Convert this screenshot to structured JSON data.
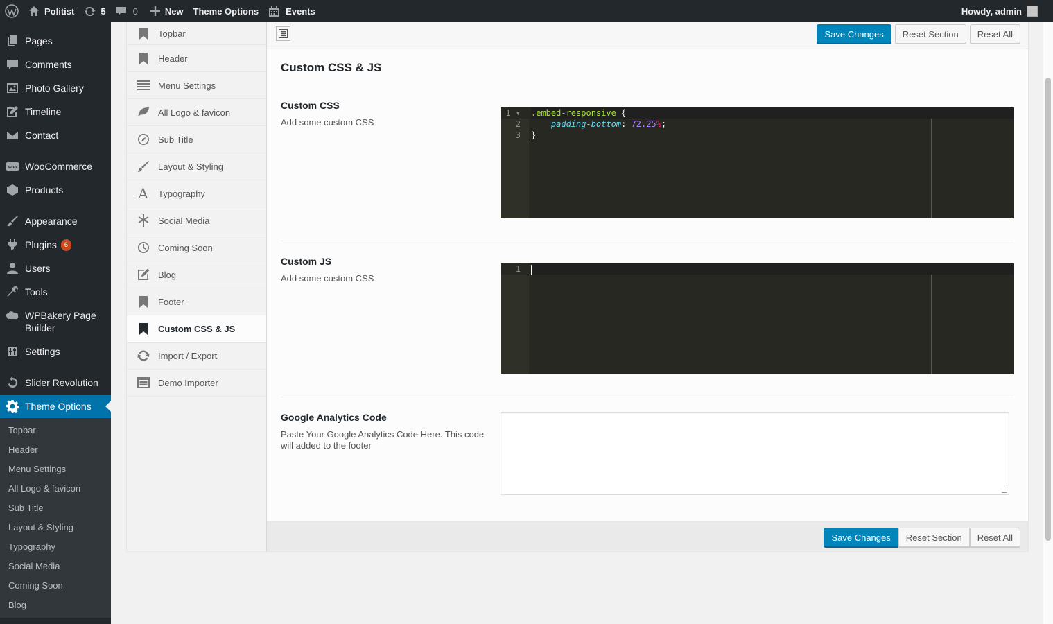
{
  "adminbar": {
    "site_name": "Politist",
    "updates_count": "5",
    "comments_count": "0",
    "new_label": "New",
    "theme_options_label": "Theme Options",
    "events_label": "Events",
    "howdy": "Howdy, admin"
  },
  "admin_menu": {
    "items": [
      {
        "label": "Pages",
        "icon": "pages-icon"
      },
      {
        "label": "Comments",
        "icon": "comments-icon"
      },
      {
        "label": "Photo Gallery",
        "icon": "gallery-icon"
      },
      {
        "label": "Timeline",
        "icon": "timeline-icon"
      },
      {
        "label": "Contact",
        "icon": "mail-icon"
      },
      {
        "label": "WooCommerce",
        "icon": "woo-icon"
      },
      {
        "label": "Products",
        "icon": "products-icon"
      },
      {
        "label": "Appearance",
        "icon": "appearance-icon"
      },
      {
        "label": "Plugins",
        "icon": "plugins-icon",
        "badge": "6"
      },
      {
        "label": "Users",
        "icon": "users-icon"
      },
      {
        "label": "Tools",
        "icon": "tools-icon"
      },
      {
        "label": "WPBakery Page Builder",
        "icon": "wpbakery-icon"
      },
      {
        "label": "Settings",
        "icon": "settings-icon"
      },
      {
        "label": "Slider Revolution",
        "icon": "slider-icon"
      },
      {
        "label": "Theme Options",
        "icon": "gear-icon",
        "current": true
      }
    ],
    "submenu": [
      "Topbar",
      "Header",
      "Menu Settings",
      "All Logo & favicon",
      "Sub Title",
      "Layout & Styling",
      "Typography",
      "Social Media",
      "Coming Soon",
      "Blog"
    ]
  },
  "redux_sidebar": {
    "items": [
      {
        "label": "Topbar",
        "icon": "bookmark-icon"
      },
      {
        "label": "Header",
        "icon": "bookmark-icon"
      },
      {
        "label": "Menu Settings",
        "icon": "menu-icon"
      },
      {
        "label": "All Logo & favicon",
        "icon": "leaf-icon"
      },
      {
        "label": "Sub Title",
        "icon": "compass-icon"
      },
      {
        "label": "Layout & Styling",
        "icon": "brush-icon"
      },
      {
        "label": "Typography",
        "icon": "typography-icon"
      },
      {
        "label": "Social Media",
        "icon": "asterisk-icon"
      },
      {
        "label": "Coming Soon",
        "icon": "clock-icon"
      },
      {
        "label": "Blog",
        "icon": "edit-icon"
      },
      {
        "label": "Footer",
        "icon": "bookmark-icon"
      },
      {
        "label": "Custom CSS & JS",
        "icon": "bookmark-icon",
        "active": true
      },
      {
        "label": "Import / Export",
        "icon": "refresh-icon"
      },
      {
        "label": "Demo Importer",
        "icon": "importer-icon"
      }
    ]
  },
  "buttons": {
    "save": "Save Changes",
    "reset_section": "Reset Section",
    "reset_all": "Reset All"
  },
  "section": {
    "title": "Custom CSS & JS",
    "custom_css": {
      "title": "Custom CSS",
      "desc": "Add some custom CSS",
      "line_numbers": [
        "1",
        "2",
        "3"
      ],
      "code": {
        "selector": ".embed-responsive",
        "brace_open": " {",
        "property": "padding-bottom",
        "colon": ": ",
        "number": "72.25",
        "unit": "%",
        "semicolon": ";",
        "brace_close": "}"
      }
    },
    "custom_js": {
      "title": "Custom JS",
      "desc": "Add some custom CSS",
      "line_numbers": [
        "1"
      ]
    },
    "ga": {
      "title": "Google Analytics Code",
      "desc": "Paste Your Google Analytics Code Here. This code will added to the footer",
      "value": ""
    }
  },
  "colors": {
    "admin_bar": "#23282d",
    "accent": "#0073aa",
    "primary_button": "#0085ba",
    "editor_bg": "#272822"
  }
}
